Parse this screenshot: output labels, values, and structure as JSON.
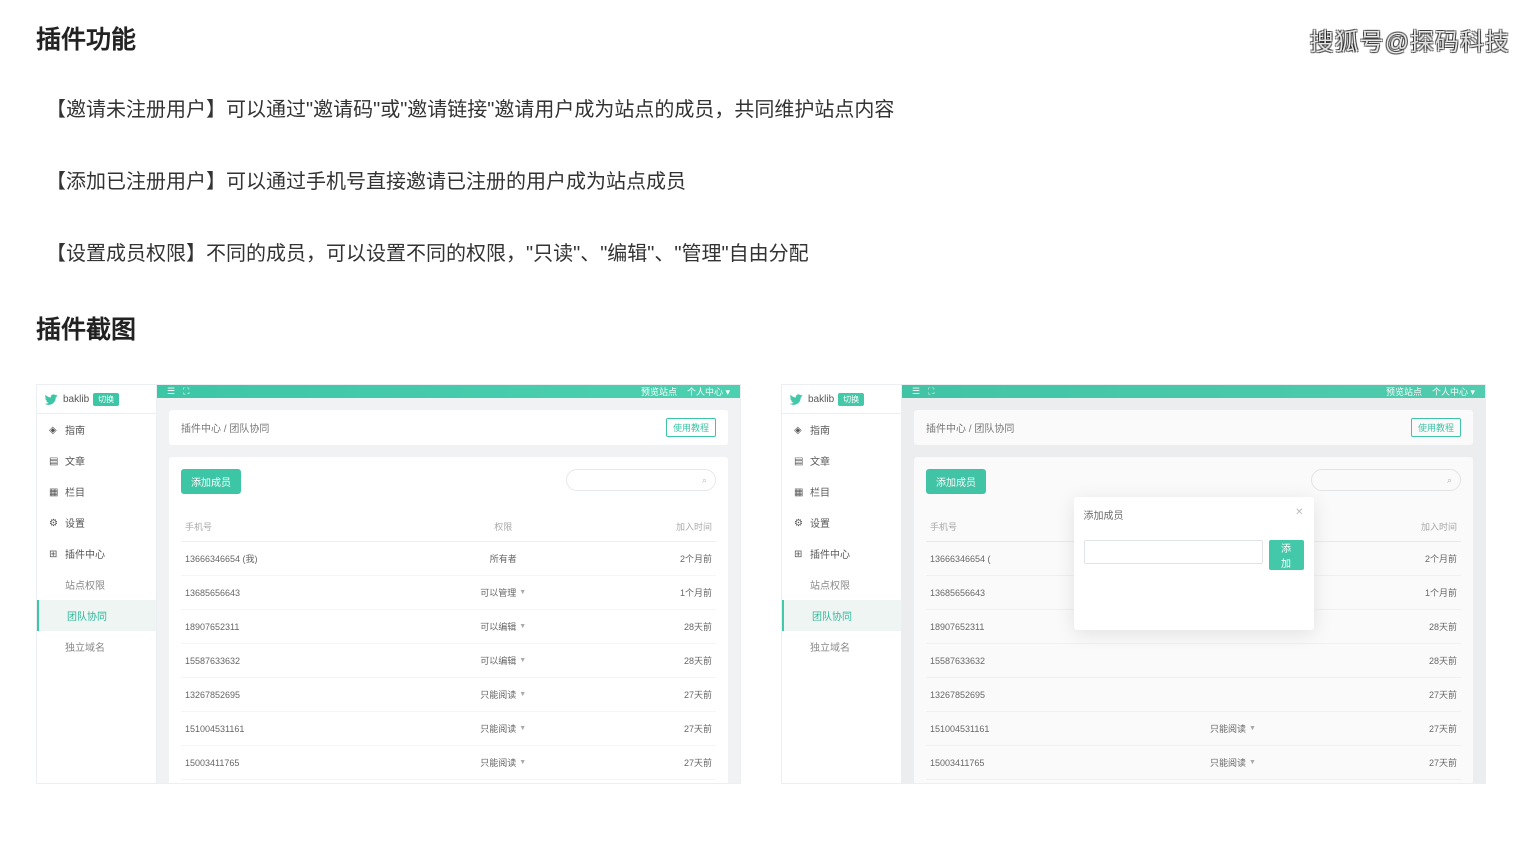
{
  "watermark": "搜狐号@探码科技",
  "headings": {
    "features": "插件功能",
    "screenshots": "插件截图"
  },
  "features": [
    "【邀请未注册用户】可以通过\"邀请码\"或\"邀请链接\"邀请用户成为站点的成员，共同维护站点内容",
    "【添加已注册用户】可以通过手机号直接邀请已注册的用户成为站点成员",
    "【设置成员权限】不同的成员，可以设置不同的权限，\"只读\"、\"编辑\"、\"管理\"自由分配"
  ],
  "app": {
    "brand": "baklib",
    "brand_badge": "切换",
    "topbar": {
      "preview": "预览站点",
      "user_center": "个人中心"
    },
    "breadcrumb": "插件中心 / 团队协同",
    "tutorial_btn": "使用教程",
    "add_member_btn": "添加成员",
    "nav": [
      {
        "label": "指南"
      },
      {
        "label": "文章"
      },
      {
        "label": "栏目"
      },
      {
        "label": "设置"
      },
      {
        "label": "插件中心"
      }
    ],
    "sub_nav": [
      {
        "label": "站点权限"
      },
      {
        "label": "团队协同",
        "active": true
      },
      {
        "label": "独立域名"
      }
    ],
    "table": {
      "headers": {
        "phone": "手机号",
        "perm": "权限",
        "joined": "加入时间"
      },
      "rows": [
        {
          "phone": "13666346654 (我)",
          "perm": "所有者",
          "joined": "2个月前",
          "caret": false
        },
        {
          "phone": "13685656643",
          "perm": "可以管理",
          "joined": "1个月前",
          "caret": true
        },
        {
          "phone": "18907652311",
          "perm": "可以编辑",
          "joined": "28天前",
          "caret": true
        },
        {
          "phone": "15587633632",
          "perm": "可以编辑",
          "joined": "28天前",
          "caret": true
        },
        {
          "phone": "13267852695",
          "perm": "只能阅读",
          "joined": "27天前",
          "caret": true
        },
        {
          "phone": "151004531161",
          "perm": "只能阅读",
          "joined": "27天前",
          "caret": true
        },
        {
          "phone": "15003411765",
          "perm": "只能阅读",
          "joined": "27天前",
          "caret": true
        }
      ]
    },
    "modal": {
      "title": "添加成员",
      "add_btn": "添加"
    }
  }
}
